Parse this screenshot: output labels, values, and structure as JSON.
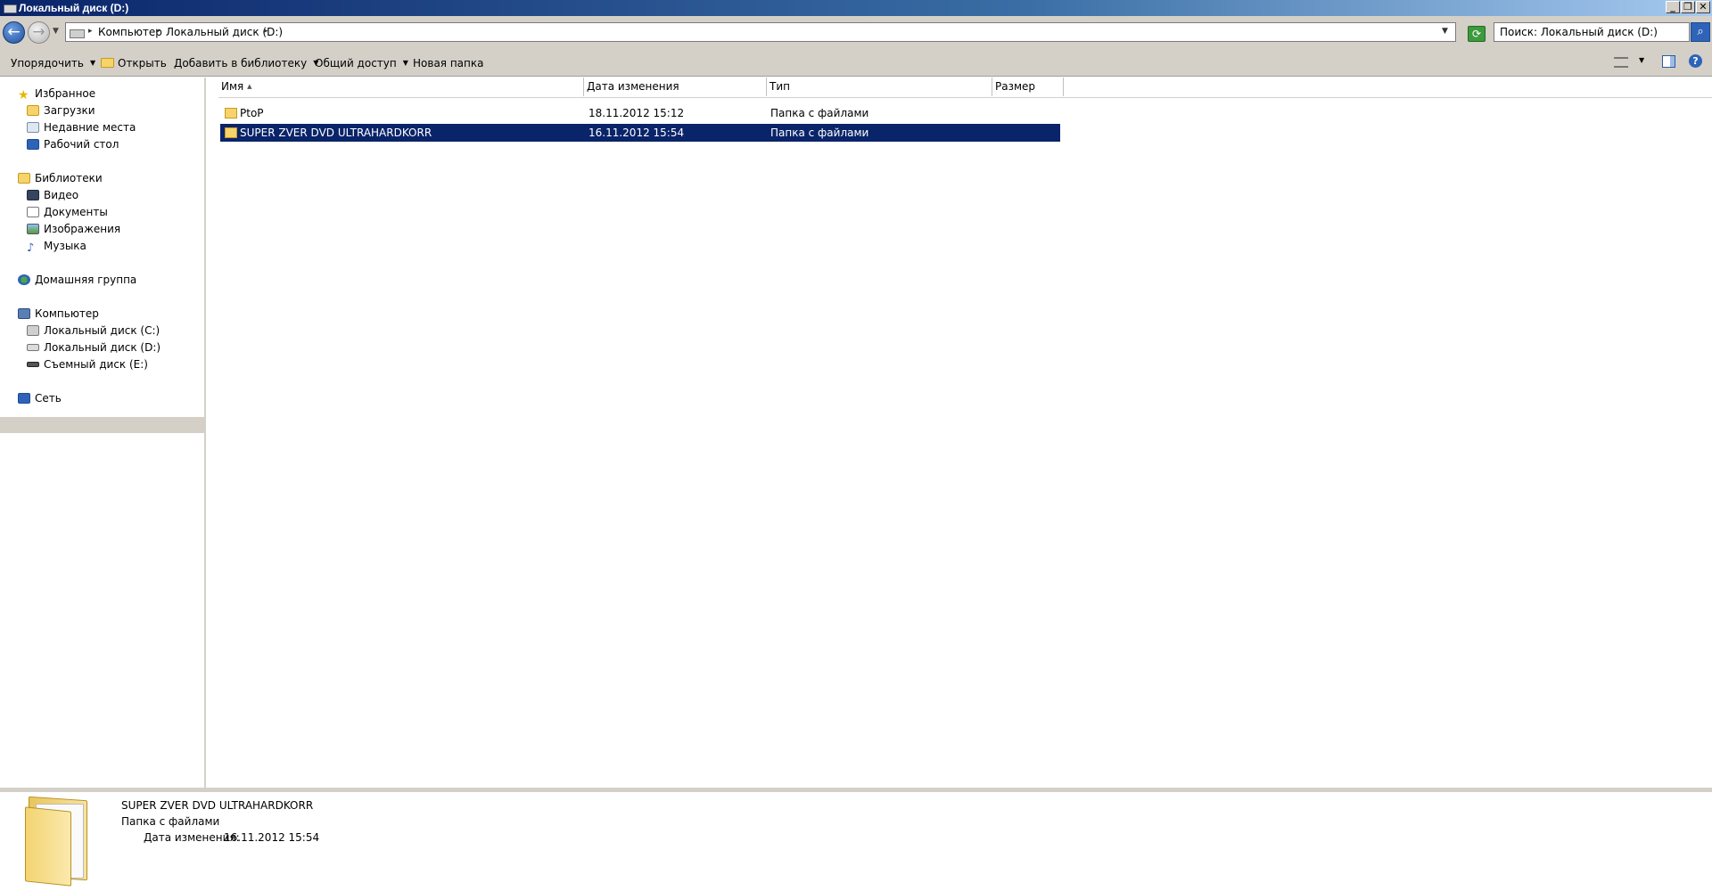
{
  "window": {
    "title": "Локальный диск (D:)"
  },
  "caption_buttons": {
    "minimize": "_",
    "restore": "❐",
    "close": "✕"
  },
  "address_bar": {
    "breadcrumbs": [
      "Компьютер",
      "Локальный диск (D:)"
    ],
    "search_placeholder": "Поиск: Локальный диск (D:)"
  },
  "command_bar": {
    "organize": "Упорядочить",
    "open": "Открыть",
    "add_to_library": "Добавить в библиотеку",
    "share": "Общий доступ",
    "new_folder": "Новая папка"
  },
  "nav_pane": {
    "favorites": {
      "label": "Избранное",
      "items": [
        "Загрузки",
        "Недавние места",
        "Рабочий стол"
      ]
    },
    "libraries": {
      "label": "Библиотеки",
      "items": [
        "Видео",
        "Документы",
        "Изображения",
        "Музыка"
      ]
    },
    "homegroup": {
      "label": "Домашняя группа"
    },
    "computer": {
      "label": "Компьютер",
      "items": [
        "Локальный диск (C:)",
        "Локальный диск (D:)",
        "Съемный диск (E:)"
      ],
      "selected": "Локальный диск (D:)"
    },
    "network": {
      "label": "Сеть"
    }
  },
  "file_list": {
    "columns": [
      "Имя",
      "Дата изменения",
      "Тип",
      "Размер"
    ],
    "rows": [
      {
        "name": "PtoP",
        "modified": "18.11.2012 15:12",
        "type": "Папка с файлами",
        "size": "",
        "selected": false
      },
      {
        "name": "SUPER ZVER DVD ULTRAHARDKORR",
        "modified": "16.11.2012 15:54",
        "type": "Папка с файлами",
        "size": "",
        "selected": true
      }
    ]
  },
  "details_pane": {
    "name": "SUPER ZVER DVD ULTRAHARDKORR",
    "type": "Папка с файлами",
    "modified_label": "Дата изменения:",
    "modified_value": "16.11.2012 15:54"
  },
  "colors": {
    "selection": "#0a246a",
    "chrome": "#d4d0c8",
    "title_gradient_start": "#0a246a",
    "title_gradient_end": "#a6caf0"
  }
}
